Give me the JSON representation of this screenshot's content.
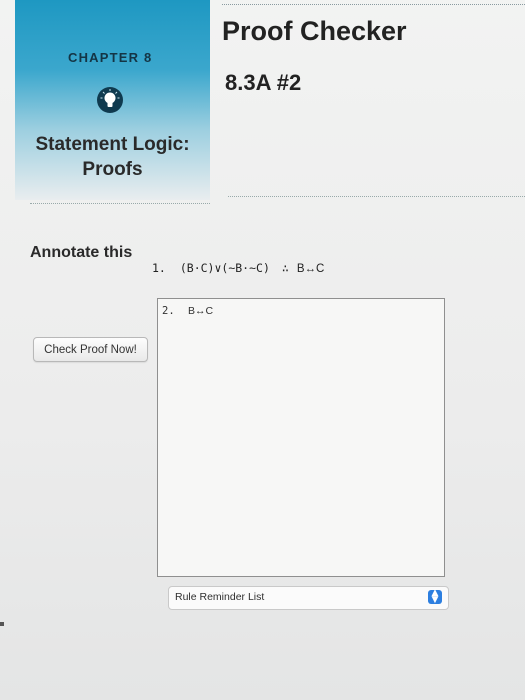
{
  "chapter": {
    "label": "CHAPTER 8",
    "title_line1": "Statement Logic:",
    "title_line2": "Proofs",
    "icon": "lightbulb-icon",
    "panel_color": "#1e98c2"
  },
  "header": {
    "title": "Proof Checker",
    "exercise": "8.3A #2"
  },
  "problem": {
    "annotate_label": "Annotate this",
    "line_number": "1.",
    "premise": "(B·C)∨(~B·~C)",
    "therefore_symbol": "∴",
    "conclusion": "B↔C"
  },
  "proof": {
    "lines": [
      {
        "number": "2.",
        "formula": "B↔C"
      }
    ]
  },
  "actions": {
    "check_button": "Check Proof Now!"
  },
  "rule_select": {
    "selected": "Rule Reminder List",
    "arrow_icon": "select-arrows-icon",
    "arrow_color": "#2d7fe0"
  }
}
